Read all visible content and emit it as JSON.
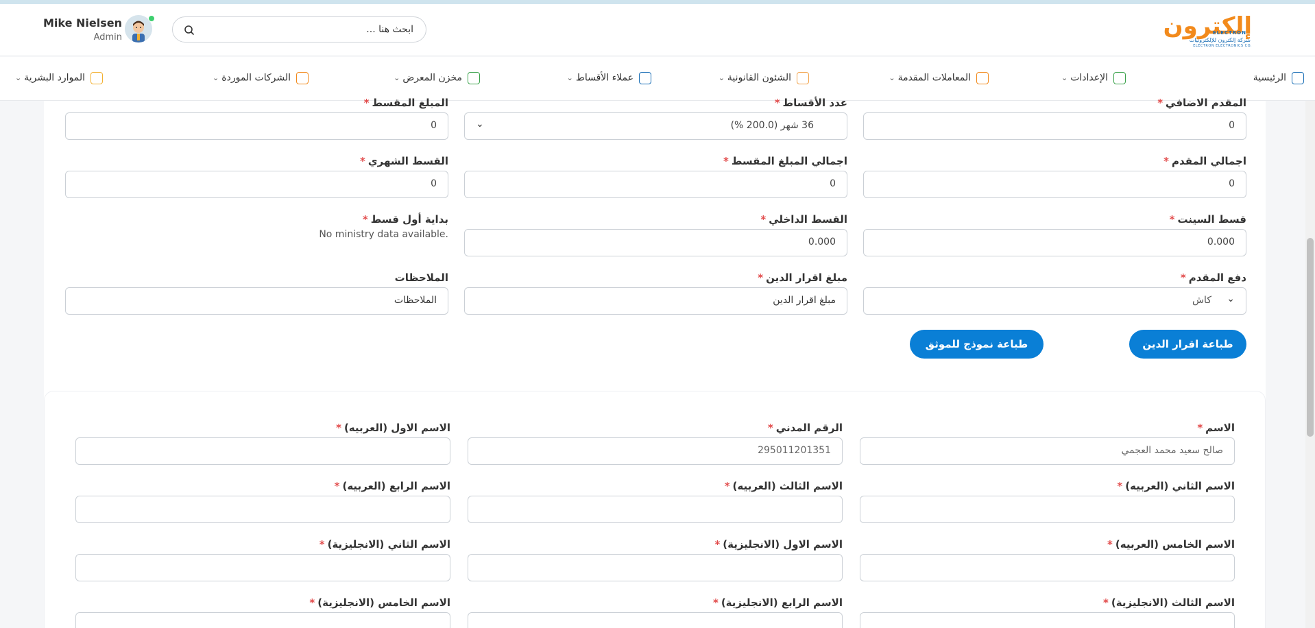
{
  "brand": {
    "logo_ar": "إلكترون",
    "logo_en": "ELECTRON",
    "logo_sub_ar": "شركة إلكترون للإلكترونيات",
    "logo_sub_en": "ELECTRON ELECTRONICS CO."
  },
  "search": {
    "placeholder": "ابحث هنا ..."
  },
  "user": {
    "name": "Mike Nielsen",
    "role": "Admin"
  },
  "nav": [
    {
      "label": "الرئيسية",
      "icon": "home-icon",
      "color": "#1b6fb6",
      "has_menu": false
    },
    {
      "label": "الإعدادات",
      "icon": "settings-icon",
      "color": "#3aa24a",
      "has_menu": true
    },
    {
      "label": "المعاملات المقدمة",
      "icon": "document-icon",
      "color": "#f28a1c",
      "has_menu": true
    },
    {
      "label": "الشئون القانونية",
      "icon": "folder-icon",
      "color": "#f2a34b",
      "has_menu": true
    },
    {
      "label": "عملاء الأقساط",
      "icon": "calendar-icon",
      "color": "#1b6fb6",
      "has_menu": true
    },
    {
      "label": "مخزن المعرض",
      "icon": "store-icon",
      "color": "#3aa24a",
      "has_menu": true
    },
    {
      "label": "الشركات الموردة",
      "icon": "company-icon",
      "color": "#f28a1c",
      "has_menu": true
    },
    {
      "label": "الموارد البشرية",
      "icon": "briefcase-icon",
      "color": "#f2b030",
      "has_menu": true
    }
  ],
  "form": {
    "extra_down_payment": {
      "label": "المقدم الاضافي",
      "value": "0"
    },
    "installments_count": {
      "label": "عدد الأقساط",
      "value": "36 شهر (200.0 %)"
    },
    "installment_amount": {
      "label": "المبلغ المقسط",
      "value": "0"
    },
    "total_down_payment": {
      "label": "اجمالي المقدم",
      "value": "0"
    },
    "total_installment_amount": {
      "label": "اجمالي المبلغ المقسط",
      "value": "0"
    },
    "monthly_installment": {
      "label": "القسط الشهري",
      "value": "0"
    },
    "sinet_installment": {
      "label": "قسط السينت",
      "value": "0.000"
    },
    "internal_installment": {
      "label": "القسط الداخلي",
      "value": "0.000"
    },
    "first_installment_start": {
      "label": "بداية أول قسط",
      "note": "No ministry data available."
    },
    "down_payment_method": {
      "label": "دفع المقدم",
      "value": "كاش"
    },
    "debt_acknowledgment_amount": {
      "label": "مبلغ اقرار الدين",
      "placeholder": "مبلغ اقرار الدين"
    },
    "notes": {
      "label": "الملاحظات",
      "placeholder": "الملاحظات"
    }
  },
  "buttons": {
    "print_debt": "طباعة اقرار الدين",
    "print_notary": "طباعة نموذج للموثق"
  },
  "customer": {
    "name": {
      "label": "الاسم",
      "value": "صالح سعيد محمد العجمي"
    },
    "civil_id": {
      "label": "الرقم المدني",
      "value": "295011201351"
    },
    "first_name_ar": {
      "label": "الاسم الاول (العربيه)",
      "value": ""
    },
    "second_name_ar": {
      "label": "الاسم الثاني (العربيه)",
      "value": ""
    },
    "third_name_ar": {
      "label": "الاسم الثالث (العربيه)",
      "value": ""
    },
    "fourth_name_ar": {
      "label": "الاسم الرابع (العربيه)",
      "value": ""
    },
    "fifth_name_ar": {
      "label": "الاسم الخامس (العربيه)",
      "value": ""
    },
    "first_name_en": {
      "label": "الاسم الاول (الانجليزية)",
      "value": ""
    },
    "second_name_en": {
      "label": "الاسم الثاني (الانجليزية)",
      "value": ""
    },
    "third_name_en": {
      "label": "الاسم الثالث (الانجليزية)",
      "value": ""
    },
    "fourth_name_en": {
      "label": "الاسم الرابع (الانجليزية)",
      "value": ""
    },
    "fifth_name_en": {
      "label": "الاسم الخامس (الانجليزية)",
      "value": ""
    }
  },
  "required_mark": "*",
  "colors": {
    "primary": "#0a7fd6",
    "required": "#e24b4b",
    "online": "#3ccf6e"
  }
}
